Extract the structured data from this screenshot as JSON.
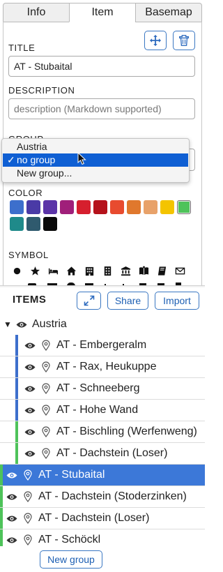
{
  "tabs": [
    {
      "label": "Info",
      "active": false
    },
    {
      "label": "Item",
      "active": true
    },
    {
      "label": "Basemap",
      "active": false
    }
  ],
  "toolbar": {
    "move_icon": "move-arrows-icon",
    "delete_icon": "trash-icon"
  },
  "title_section": {
    "label": "TITLE",
    "value": "AT - Stubaital"
  },
  "description_section": {
    "label": "DESCRIPTION",
    "placeholder": "description (Markdown supported)",
    "value": ""
  },
  "group_section": {
    "label": "GROUP",
    "options": [
      {
        "label": "Austria",
        "selected": false
      },
      {
        "label": "no group",
        "selected": true
      },
      {
        "label": "New group...",
        "selected": false
      }
    ],
    "check_mark": "✓"
  },
  "color_section": {
    "label": "COLOR",
    "colors": [
      "#3d6fcc",
      "#4a3aa6",
      "#5b34a8",
      "#a01f7a",
      "#d61f2e",
      "#b5121b",
      "#e84b2f",
      "#e0782d",
      "#e8a26a",
      "#f4c400",
      "#4ec35a",
      "#1f8a8a",
      "#2f5a6e",
      "#0a0a0a"
    ],
    "selected_index": 10
  },
  "symbol_section": {
    "label": "SYMBOL",
    "symbols": [
      "circle-icon",
      "star-icon",
      "bed-icon",
      "home-icon",
      "building-icon",
      "office-icon",
      "bank-icon",
      "book-open-icon",
      "book-icon",
      "mail-icon"
    ]
  },
  "items_panel": {
    "title": "ITEMS",
    "expand_icon": "expand-icon",
    "share_label": "Share",
    "import_label": "Import",
    "group_name": "Austria",
    "rows": [
      {
        "label": "AT - Embergeralm",
        "bar_color": "#3d6fcc",
        "indent": true,
        "selected": false
      },
      {
        "label": "AT - Rax, Heukuppe",
        "bar_color": "#3d6fcc",
        "indent": true,
        "selected": false
      },
      {
        "label": "AT - Schneeberg",
        "bar_color": "#3d6fcc",
        "indent": true,
        "selected": false
      },
      {
        "label": "AT - Hohe Wand",
        "bar_color": "#3d6fcc",
        "indent": true,
        "selected": false
      },
      {
        "label": "AT - Bischling (Werfenweng)",
        "bar_color": "#4ec35a",
        "indent": true,
        "selected": false
      },
      {
        "label": "AT - Dachstein (Loser)",
        "bar_color": "#4ec35a",
        "indent": true,
        "selected": false
      },
      {
        "label": "AT - Stubaital",
        "bar_color": "#4ec35a",
        "indent": false,
        "selected": true
      },
      {
        "label": "AT - Dachstein (Stoderzinken)",
        "bar_color": "#4ec35a",
        "indent": false,
        "selected": false
      },
      {
        "label": "AT - Dachstein (Loser)",
        "bar_color": "#4ec35a",
        "indent": false,
        "selected": false
      },
      {
        "label": "AT - Schöckl",
        "bar_color": "#4ec35a",
        "indent": false,
        "selected": false
      }
    ],
    "new_group_label": "New group"
  }
}
